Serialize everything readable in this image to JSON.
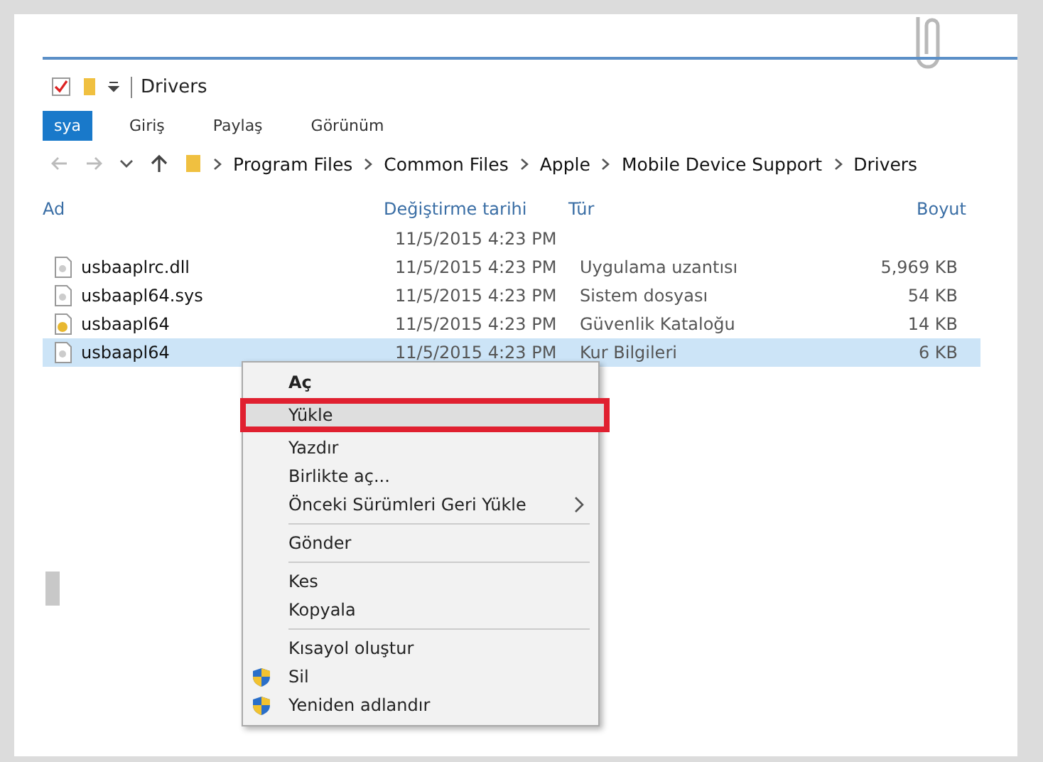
{
  "window": {
    "title": "Drivers"
  },
  "ribbon_tabs": [
    {
      "label": "sya",
      "selected": true
    },
    {
      "label": "Giriş",
      "selected": false
    },
    {
      "label": "Paylaş",
      "selected": false
    },
    {
      "label": "Görünüm",
      "selected": false
    }
  ],
  "address_bar": {
    "path": [
      "Program Files",
      "Common Files",
      "Apple",
      "Mobile Device Support",
      "Drivers"
    ]
  },
  "table": {
    "columns": [
      "Ad",
      "Değiştirme tarihi",
      "Tür",
      "Boyut"
    ],
    "rows": [
      {
        "kind": "partial",
        "date": "11/5/2015 4:23 PM",
        "selected": false
      },
      {
        "kind": "file",
        "name": "usbaaplrc.dll",
        "date": "11/5/2015 4:23 PM",
        "type": "Uygulama uzantısı",
        "size": "5,969 KB",
        "selected": false
      },
      {
        "kind": "file",
        "name": "usbaapl64.sys",
        "date": "11/5/2015 4:23 PM",
        "type": "Sistem dosyası",
        "size": "54 KB",
        "selected": false
      },
      {
        "kind": "catalog",
        "name": "usbaapl64",
        "date": "11/5/2015 4:23 PM",
        "type": "Güvenlik Kataloğu",
        "size": "14 KB",
        "selected": false
      },
      {
        "kind": "file",
        "name": "usbaapl64",
        "date": "11/5/2015 4:23 PM",
        "type": "Kur Bilgileri",
        "size": "6 KB",
        "selected": true
      }
    ]
  },
  "context_menu": [
    {
      "kind": "default",
      "label": "Aç",
      "selected": false
    },
    {
      "kind": "item",
      "label": "Yükle",
      "selected": true
    },
    {
      "kind": "item",
      "label": "Yazdır",
      "selected": false
    },
    {
      "kind": "item",
      "label": "Birlikte aç...",
      "selected": false
    },
    {
      "kind": "submenu",
      "label": "Önceki Sürümleri Geri Yükle",
      "selected": false
    },
    {
      "kind": "separator"
    },
    {
      "kind": "item",
      "label": "Gönder",
      "selected": false
    },
    {
      "kind": "separator"
    },
    {
      "kind": "item",
      "label": "Kes",
      "selected": false
    },
    {
      "kind": "item",
      "label": "Kopyala",
      "selected": false
    },
    {
      "kind": "separator"
    },
    {
      "kind": "item",
      "label": "Kısayol oluştur",
      "selected": false
    },
    {
      "kind": "shield",
      "label": "Sil",
      "selected": false
    },
    {
      "kind": "shield",
      "label": "Yeniden adlandır",
      "selected": false
    }
  ]
}
